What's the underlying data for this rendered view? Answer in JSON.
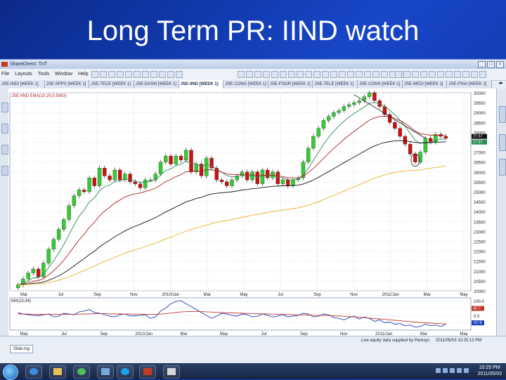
{
  "slide": {
    "title": "Long Term PR: IIND watch"
  },
  "window": {
    "title": "ShareDirect: TnT"
  },
  "menu": [
    "File",
    "Layouts",
    "Tools",
    "Window",
    "Help"
  ],
  "tabs": [
    "JSE-INDI [WEEK 1]",
    "JSE-SPPS [WEEK 1]",
    "JSE-TECE [WEEK 1]",
    "JSE-DASM [WEEK 1]",
    "JSE-IIND [WEEK 1]",
    "JSE-CONG [WEEK 1]",
    "JSE-FOOR [WEEK 1]",
    "JSE-TELE [WEEK 1]",
    "JSE-CONS [WEEK 1]",
    "JSE-MEDI [WEEK 1]",
    "JSE-FINA [WEEK 1]"
  ],
  "active_tab": "JSE-IIND [WEEK 1]",
  "sheet_tab": "Slide.log",
  "status": {
    "notice": "Live equity data supplied by Peresys",
    "timestamp": "2011/05/03 10:25:13 PM"
  },
  "clock": {
    "time": "10:25 PM",
    "date": "2011/05/03"
  },
  "colors": {
    "bull": "#33cc33",
    "bear": "#cc1111",
    "ema_fast": "#2e8b57",
    "ema_mid": "#b22222",
    "ema_slow": "#111111",
    "ema_long": "#e6b422",
    "indicator": "#1f3fbf",
    "indicator_signal": "#c0392b"
  },
  "chart_data": [
    {
      "type": "candlestick",
      "legend": "JSE-IIND EMA(10,20,0.5083)",
      "x_labels_top": [
        "Mar",
        "Jul",
        "Sep",
        "Nov",
        "2010/Jan",
        "Mar",
        "May",
        "Jul",
        "Sep",
        "Nov",
        "2011/Jan",
        "Mar",
        "May"
      ],
      "y_ticks": [
        "30000",
        "29500",
        "29000",
        "28500",
        "28000",
        "27500",
        "27000",
        "26500",
        "26000",
        "25500",
        "25000",
        "24500",
        "24000",
        "23500",
        "23000",
        "22500",
        "22000",
        "21500",
        "21000",
        "20500",
        "20000"
      ],
      "ylim": [
        20000,
        30000
      ],
      "price_flags": [
        "27.67",
        "27.67"
      ],
      "closes": [
        20300,
        20600,
        20900,
        21100,
        20700,
        21400,
        22100,
        22600,
        23100,
        23600,
        24300,
        24800,
        25100,
        25000,
        25700,
        25300,
        26200,
        25800,
        25600,
        26100,
        25600,
        25900,
        25500,
        25400,
        25200,
        25600,
        25600,
        25900,
        26500,
        26800,
        26400,
        26800,
        26600,
        27100,
        26000,
        26400,
        25800,
        26700,
        26200,
        25600,
        25500,
        25300,
        25600,
        25800,
        26000,
        25600,
        26000,
        25400,
        26100,
        25700,
        26000,
        25400,
        25600,
        25300,
        25600,
        25700,
        26500,
        27200,
        27800,
        28200,
        28600,
        28800,
        29000,
        29100,
        29300,
        29400,
        29500,
        29600,
        29800,
        30000,
        29600,
        29300,
        28900,
        28500,
        28200,
        27800,
        27400,
        26900,
        26500,
        27000,
        27700,
        27500,
        27900,
        27800,
        27700
      ]
    },
    {
      "type": "line",
      "legend": "MA(13,34)",
      "x_labels_bottom": [
        "May",
        "Jul",
        "Sep",
        "2010/Jan",
        "Mar",
        "May",
        "Jul",
        "Sep",
        "Nov",
        "2011/Jan",
        "Mar",
        "May"
      ],
      "y_ticks": [
        "100.0",
        "50.0",
        "0.0",
        "-50.0"
      ],
      "ylim": [
        -100,
        120
      ],
      "badges": [
        "40.7",
        "-57.6"
      ],
      "series": [
        {
          "values": [
            20,
            10,
            5,
            0,
            -2,
            5,
            10,
            -10,
            -5,
            15,
            10,
            5,
            25,
            30,
            40,
            20,
            15,
            5,
            -5,
            -10,
            5,
            10,
            -5,
            -2,
            0,
            5,
            -20,
            -10,
            30,
            50,
            80,
            95,
            100,
            80,
            60,
            40,
            20,
            0,
            -20,
            -5,
            15,
            10,
            0,
            -5,
            10,
            5,
            -10,
            -5,
            10,
            0,
            -10,
            -5,
            5,
            -10,
            -5,
            0,
            15,
            10,
            -10,
            -5,
            10,
            5,
            -15,
            -20,
            -30,
            -15,
            -5,
            -25,
            -10,
            -20,
            -40,
            -30,
            -50,
            -45,
            -60,
            -55,
            -70,
            -65,
            -80,
            -75,
            -60,
            -70,
            -65,
            -75,
            -60
          ]
        },
        {
          "values": [
            10,
            10,
            9,
            8,
            8,
            8,
            8,
            7,
            7,
            7,
            8,
            8,
            9,
            10,
            11,
            12,
            12,
            12,
            11,
            10,
            10,
            10,
            9,
            9,
            9,
            8,
            7,
            7,
            9,
            12,
            16,
            20,
            24,
            26,
            27,
            27,
            26,
            25,
            23,
            21,
            19,
            18,
            17,
            16,
            15,
            14,
            13,
            12,
            11,
            10,
            9,
            8,
            7,
            6,
            5,
            4,
            4,
            3,
            2,
            1,
            0,
            -1,
            -2,
            -4,
            -6,
            -8,
            -10,
            -12,
            -15,
            -18,
            -21,
            -24,
            -27,
            -30,
            -33,
            -36,
            -39,
            -42,
            -45,
            -48,
            -50,
            -52,
            -54,
            -56,
            -57
          ]
        }
      ]
    }
  ]
}
